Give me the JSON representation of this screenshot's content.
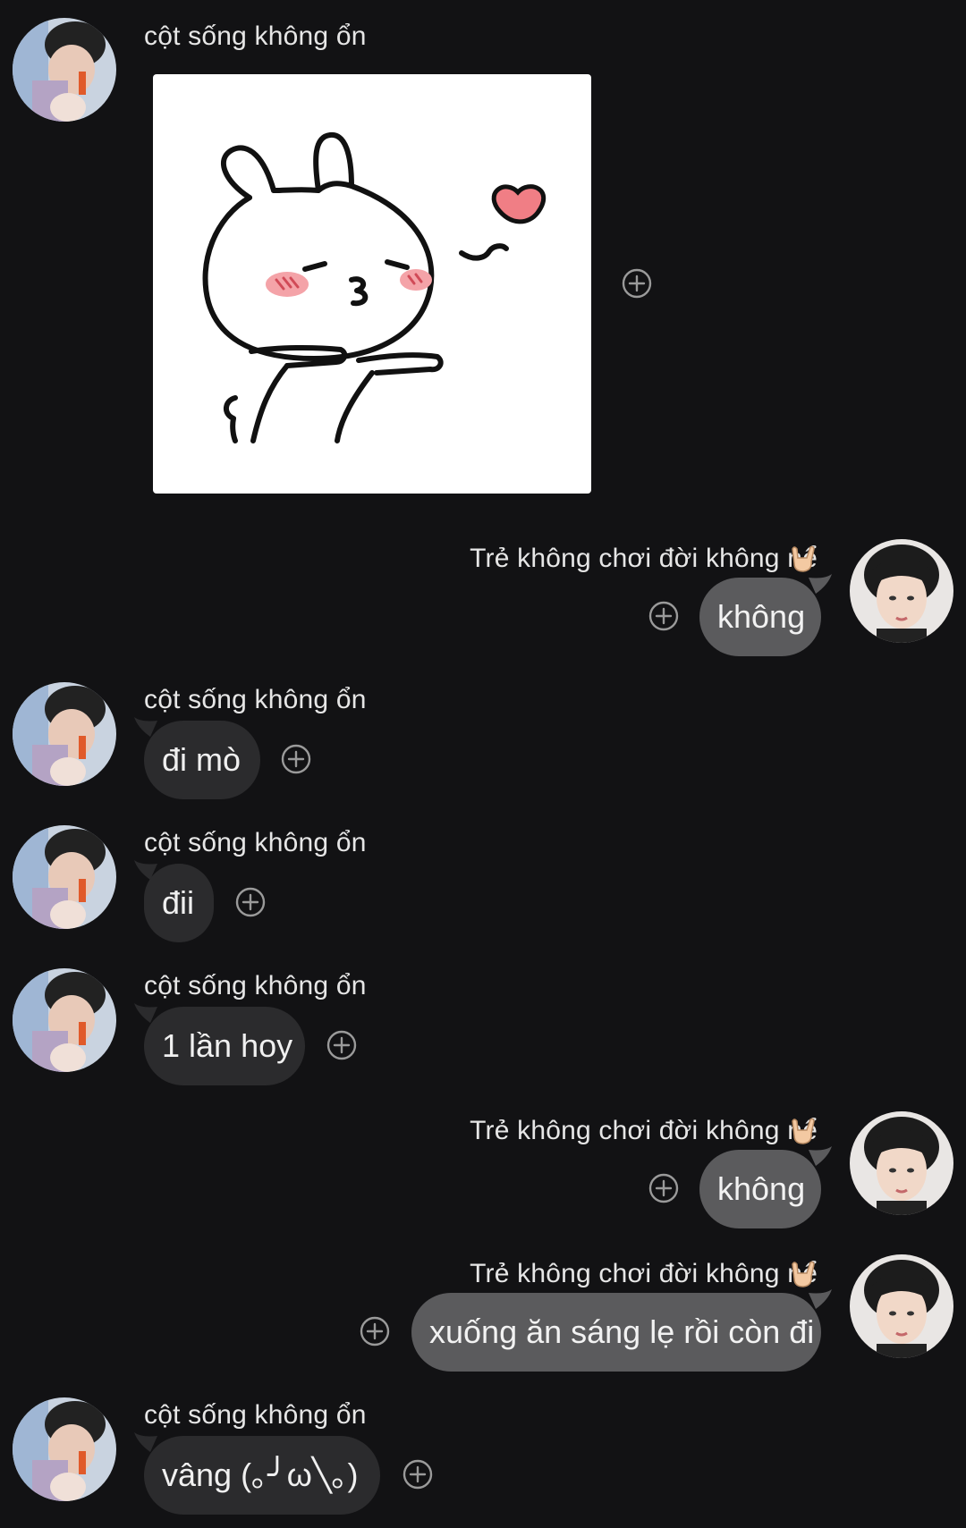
{
  "contacts": {
    "left_name": "cột sống không ổn",
    "right_name": "Trẻ không chơi đời không nể",
    "right_emoji": "rock-hand-emoji"
  },
  "messages": {
    "m2": "không",
    "m3": "đi mò",
    "m4": "đii",
    "m5": "1 lần hoy",
    "m6": "không",
    "m7": "xuống ăn sáng lẹ rồi còn đi",
    "m8": "vâng (｡╯ω╲｡)"
  },
  "colors": {
    "background": "#121214",
    "incoming_bubble": "#2b2b2d",
    "outgoing_bubble": "#5b5b5d"
  }
}
